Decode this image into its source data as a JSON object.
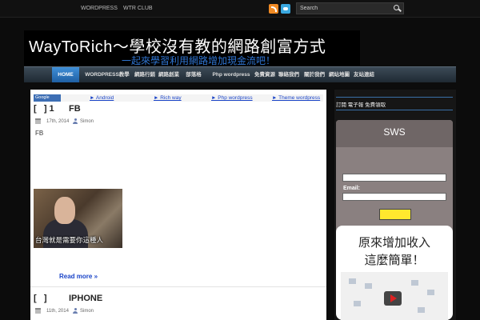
{
  "topbar": {
    "links": [
      "WORDPRESS",
      "WTR CLUB"
    ],
    "search_placeholder": "Search"
  },
  "banner": {
    "title": "WayToRich～學校沒有教的網路創富方式",
    "subtitle": "一起來學習利用網路增加現金流吧！"
  },
  "nav": {
    "items": [
      "HOME",
      "WORDPRESS教學",
      "網路行銷",
      "網路創業",
      "部落格",
      "Php wordpress",
      "免費資源",
      "聯絡我們",
      "關於我們",
      "網站地圖",
      "友站連結"
    ]
  },
  "adlinks": {
    "badge": "Google",
    "links": [
      "► Android",
      "► Rich way",
      "► Php wordpress",
      "► Theme wordpress"
    ]
  },
  "posts": [
    {
      "title": "[   ] 1      FB",
      "date": "17th, 2014",
      "author": "Simon",
      "excerpt": "FB",
      "image_caption": "台灣就是需要你這種人",
      "read_more": "Read more »"
    },
    {
      "title": "[   ]         IPHONE",
      "date": "11th, 2014",
      "author": "Simon"
    }
  ],
  "sidebar": {
    "heading": "訂閱 電子報 免費領取",
    "sws_title": "SWS",
    "email_label": "Email:",
    "ad_line1": "原來增加收入",
    "ad_line2": "這麼簡單！"
  },
  "colors": {
    "background": "#0c0c0c",
    "nav_active": "#2f7dc9",
    "link": "#1a44c8",
    "banner_subtitle": "#2f74d0",
    "submit_button": "#ffe82e"
  }
}
